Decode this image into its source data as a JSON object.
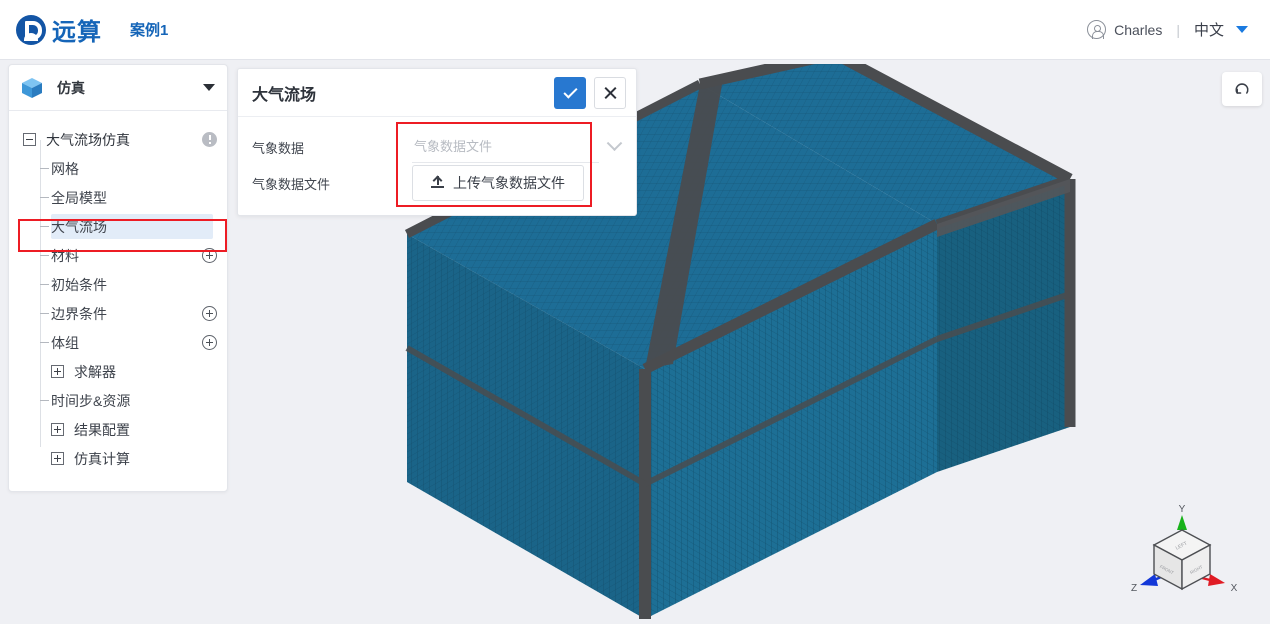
{
  "header": {
    "logo_text": "远算",
    "logo_icon": "brand-logo-icon",
    "case_title": "案例1",
    "user_icon": "user-avatar-icon",
    "user_name": "Charles",
    "divider": "|",
    "language": "中文",
    "caret_icon": "caret-down-icon"
  },
  "sidebar": {
    "head": {
      "icon": "blue-cube-icon",
      "title": "仿真",
      "caret": "caret-down-icon"
    },
    "tree": [
      {
        "label": "大气流场仿真",
        "level": "root",
        "toggle": "minus",
        "icon": "info-icon",
        "selected": false
      },
      {
        "label": "网格",
        "level": "child",
        "toggle": "none",
        "icon": "none",
        "selected": false
      },
      {
        "label": "全局模型",
        "level": "child",
        "toggle": "none",
        "icon": "none",
        "selected": false
      },
      {
        "label": "大气流场",
        "level": "child",
        "toggle": "none",
        "icon": "none",
        "selected": true
      },
      {
        "label": "材料",
        "level": "child",
        "toggle": "none",
        "icon": "plus-icon",
        "selected": false
      },
      {
        "label": "初始条件",
        "level": "child",
        "toggle": "none",
        "icon": "none",
        "selected": false
      },
      {
        "label": "边界条件",
        "level": "child",
        "toggle": "none",
        "icon": "plus-icon",
        "selected": false
      },
      {
        "label": "体组",
        "level": "child",
        "toggle": "none",
        "icon": "plus-icon",
        "selected": false
      },
      {
        "label": "求解器",
        "level": "sub",
        "toggle": "plus",
        "icon": "none",
        "selected": false
      },
      {
        "label": "时间步&资源",
        "level": "child",
        "toggle": "none",
        "icon": "none",
        "selected": false
      },
      {
        "label": "结果配置",
        "level": "sub",
        "toggle": "plus",
        "icon": "none",
        "selected": false
      },
      {
        "label": "仿真计算",
        "level": "sub",
        "toggle": "plus",
        "icon": "none",
        "selected": false
      }
    ]
  },
  "panel": {
    "title": "大气流场",
    "confirm_icon": "check-icon",
    "cancel_icon": "close-icon",
    "rows": [
      {
        "label": "气象数据",
        "control": "select",
        "placeholder": "气象数据文件",
        "value": "",
        "chevron": "chevron-down-icon"
      },
      {
        "label": "气象数据文件",
        "control": "upload",
        "button_label": "上传气象数据文件",
        "button_icon": "upload-icon"
      }
    ]
  },
  "viewport": {
    "reset_button_icon": "rotate-reset-icon",
    "axis_gizmo": {
      "x_label": "X",
      "y_label": "Y",
      "z_label": "Z",
      "x_color": "#e01b24",
      "y_color": "#18b21a",
      "z_color": "#1338d8",
      "face_labels": [
        "LEFT",
        "FRONT",
        "RIGHT"
      ]
    },
    "model": {
      "name": "atmospheric-flow-mesh-box",
      "mesh_fill": "#1b6289",
      "edge_color": "#4b4d50"
    }
  },
  "colors": {
    "accent": "#2878d0",
    "brand": "#1565b8",
    "highlight_outline": "#ed1c24",
    "selection_bg": "#e2ecf8",
    "page_bg": "#eff0f4"
  }
}
